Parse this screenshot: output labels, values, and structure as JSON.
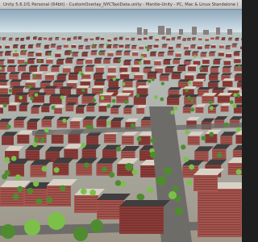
{
  "window": {
    "title": "Unity 5.6.1f1 Personal (64bit) - CustomOverlay_NYCTaxiData.unity - Mantle-Unity - PC, Mac & Linux Standalone (Personal) <OpenGL 4.1>"
  },
  "viewport": {
    "scene": "3D city block scene",
    "colors": {
      "sky_top": "#8fa9bd",
      "sky_bottom": "#d9e6ec",
      "ground": "#9d9688",
      "road": "#6e6c68",
      "brick": "#8a3b37",
      "brick_light": "#a4544d",
      "roof_light": "#d8d2c6",
      "roof_dark": "#3f3d3d",
      "tree": "#4f8c2f",
      "tree_light": "#7cc04a"
    }
  }
}
